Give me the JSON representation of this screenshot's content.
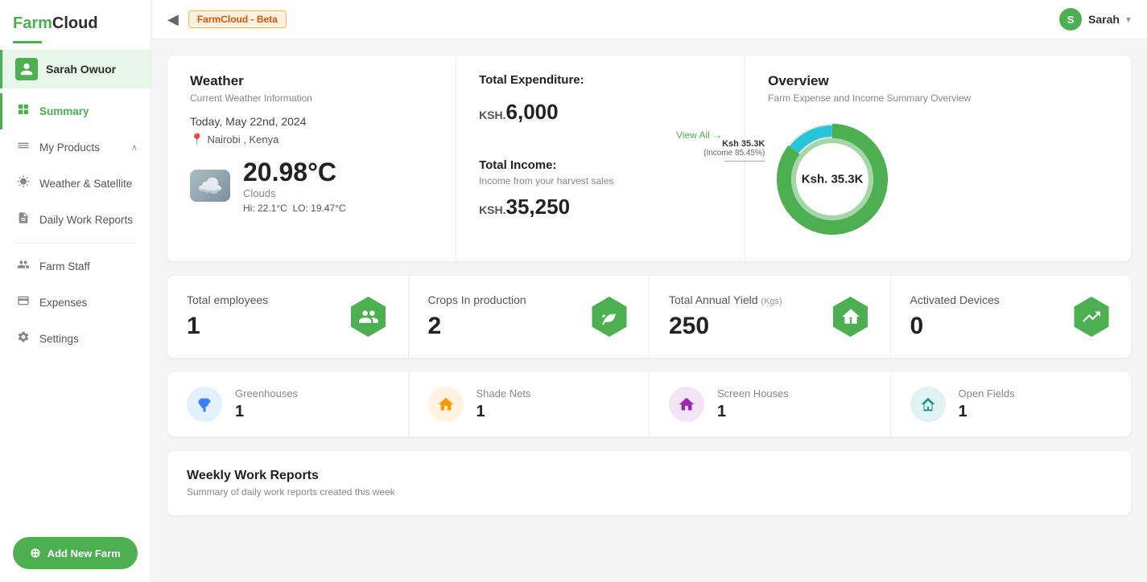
{
  "app": {
    "name": "FarmCloud",
    "name_farm": "Farm",
    "name_cloud": "Cloud",
    "beta_badge": "FarmCloud - Beta"
  },
  "sidebar": {
    "user": {
      "name": "Sarah Owuor",
      "initial": "S"
    },
    "nav_items": [
      {
        "id": "summary",
        "label": "Summary",
        "icon": "⊙",
        "active": true
      },
      {
        "id": "products",
        "label": "My Products",
        "icon": "☰",
        "has_chevron": true
      },
      {
        "id": "weather",
        "label": "Weather & Satellite",
        "icon": "⛅"
      },
      {
        "id": "reports",
        "label": "Daily Work Reports",
        "icon": "📋"
      },
      {
        "id": "staff",
        "label": "Farm Staff",
        "icon": "👥"
      },
      {
        "id": "expenses",
        "label": "Expenses",
        "icon": "💳"
      },
      {
        "id": "settings",
        "label": "Settings",
        "icon": "⚙"
      }
    ],
    "add_farm_button": "Add New Farm"
  },
  "topbar": {
    "user_name": "Sarah",
    "user_initial": "S"
  },
  "weather": {
    "title": "Weather",
    "subtitle": "Current Weather Information",
    "date": "Today, May 22nd, 2024",
    "location": "Nairobi , Kenya",
    "temperature": "20.98°C",
    "description": "Clouds",
    "hi": "Hi: 22.1°C",
    "lo": "LO: 19.47°C"
  },
  "expenditure": {
    "title": "Total Expenditure:",
    "prefix": "KSH.",
    "amount": "6,000",
    "view_all": "View All →",
    "income_title": "Total Income:",
    "income_subtitle": "Income from your harvest sales",
    "income_prefix": "KSH.",
    "income_amount": "35,250"
  },
  "overview": {
    "title": "Overview",
    "subtitle": "Farm Expense and Income Summary Overview",
    "center_label": "Ksh. 35.3K",
    "legend_annotation_label": "Ksh 35.3K",
    "legend_annotation_sub": "(Income 85.45%)",
    "segments": [
      {
        "label": "Income",
        "color": "#4caf50",
        "percent": 85.45
      },
      {
        "label": "Expense",
        "color": "#26c6da",
        "percent": 14.55
      }
    ]
  },
  "stats": [
    {
      "id": "employees",
      "label": "Total employees",
      "value": "1",
      "icon": "👥",
      "unit": ""
    },
    {
      "id": "crops",
      "label": "Crops In production",
      "value": "2",
      "icon": "🌱",
      "unit": ""
    },
    {
      "id": "yield",
      "label": "Total Annual Yield",
      "value": "250",
      "icon": "🌾",
      "unit": "(Kgs)"
    },
    {
      "id": "devices",
      "label": "Activated Devices",
      "value": "0",
      "icon": "📈",
      "unit": ""
    }
  ],
  "facilities": [
    {
      "id": "greenhouses",
      "label": "Greenhouses",
      "count": "1",
      "icon": "🏠",
      "color": "blue"
    },
    {
      "id": "shade_nets",
      "label": "Shade Nets",
      "count": "1",
      "icon": "🏠",
      "color": "orange"
    },
    {
      "id": "screen_houses",
      "label": "Screen Houses",
      "count": "1",
      "icon": "🏠",
      "color": "purple"
    },
    {
      "id": "open_fields",
      "label": "Open Fields",
      "count": "1",
      "icon": "🏡",
      "color": "teal"
    }
  ],
  "weekly": {
    "title": "Weekly Work Reports",
    "subtitle": "Summary of daily work reports created this week"
  }
}
